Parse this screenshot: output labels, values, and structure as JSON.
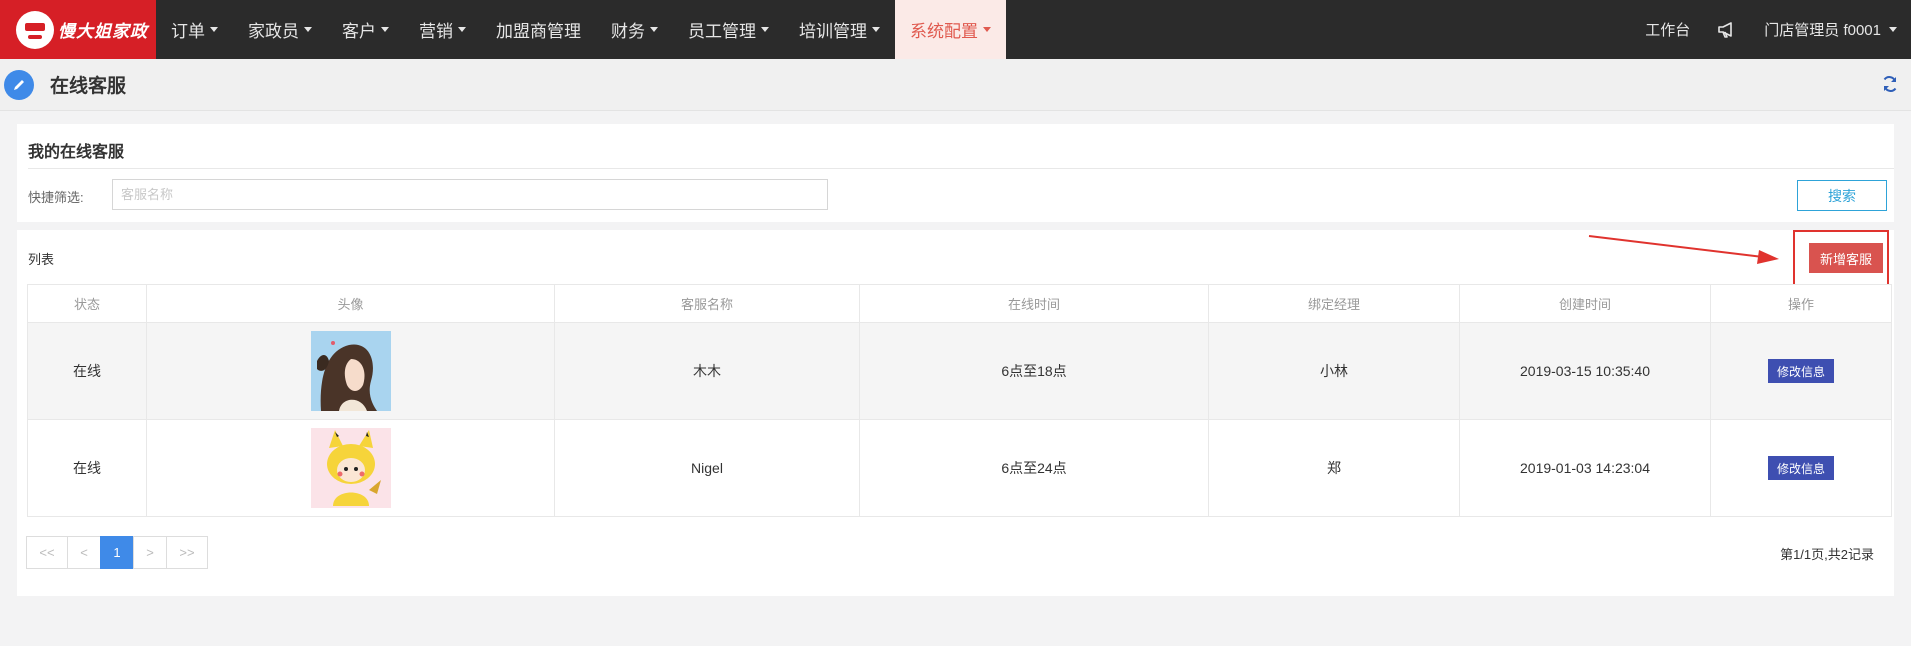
{
  "brand": {
    "name": "慢大姐家政"
  },
  "nav": {
    "items": [
      {
        "label": "订单",
        "dropdown": true
      },
      {
        "label": "家政员",
        "dropdown": true
      },
      {
        "label": "客户",
        "dropdown": true
      },
      {
        "label": "营销",
        "dropdown": true
      },
      {
        "label": "加盟商管理",
        "dropdown": false
      },
      {
        "label": "财务",
        "dropdown": true
      },
      {
        "label": "员工管理",
        "dropdown": true
      },
      {
        "label": "培训管理",
        "dropdown": true
      },
      {
        "label": "系统配置",
        "dropdown": true,
        "active": true
      }
    ],
    "workbench": "工作台",
    "user": "门店管理员  f0001"
  },
  "page": {
    "title": "在线客服"
  },
  "filter": {
    "panel_title": "我的在线客服",
    "label": "快捷筛选:",
    "placeholder": "客服名称",
    "value": "",
    "search_label": "搜索"
  },
  "list": {
    "label": "列表",
    "add_label": "新增客服",
    "columns": [
      "状态",
      "头像",
      "客服名称",
      "在线时间",
      "绑定经理",
      "创建时间",
      "操作"
    ],
    "rows": [
      {
        "status": "在线",
        "avatar": "avatar-anime-girl",
        "name": "木木",
        "online_time": "6点至18点",
        "manager": "小林",
        "created": "2019-03-15 10:35:40",
        "action": "修改信息"
      },
      {
        "status": "在线",
        "avatar": "avatar-pikachu-kid",
        "name": "Nigel",
        "online_time": "6点至24点",
        "manager": "郑",
        "created": "2019-01-03 14:23:04",
        "action": "修改信息"
      }
    ]
  },
  "pagination": {
    "first": "<<",
    "prev": "<",
    "current": "1",
    "next": ">",
    "last": ">>",
    "info": "第1/1页,共2记录"
  },
  "colors": {
    "brand_red": "#d61f26",
    "accent_blue": "#3f8ae8",
    "online_green": "#23b37a",
    "edit_button": "#3e4fb1",
    "add_button": "#d9534f"
  }
}
